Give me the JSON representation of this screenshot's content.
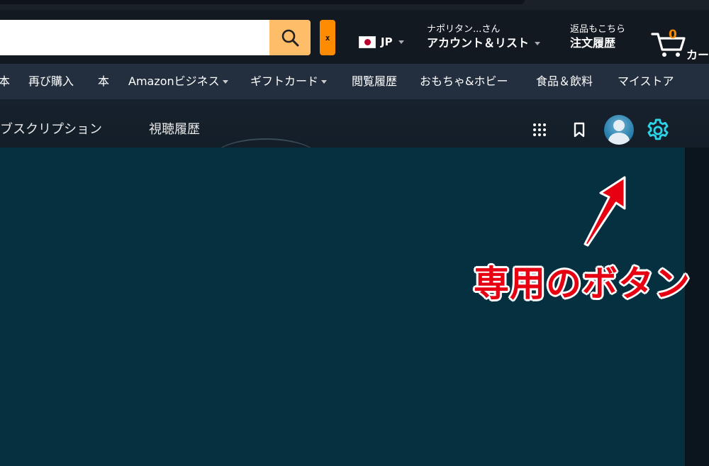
{
  "header": {
    "search": {
      "value": "",
      "placeholder": ""
    },
    "clear_label": "x",
    "language": {
      "code": "JP"
    },
    "account": {
      "greeting": "ナポリタン...さん",
      "label": "アカウント＆リスト"
    },
    "orders": {
      "line1": "返品もこちら",
      "line2": "注文履歴"
    },
    "cart": {
      "count": "0",
      "label": "カート"
    }
  },
  "nav": {
    "items": [
      {
        "label": "本",
        "caret": false
      },
      {
        "label": "再び購入",
        "caret": false
      },
      {
        "label": "本",
        "caret": false
      },
      {
        "label": "Amazonビジネス",
        "caret": true
      },
      {
        "label": "ギフトカード",
        "caret": true
      },
      {
        "label": "閲覧履歴",
        "caret": false
      },
      {
        "label": "おもちゃ&ホビー",
        "caret": false
      },
      {
        "label": "食品＆飲料",
        "caret": false
      },
      {
        "label": "マイストア",
        "caret": false
      }
    ]
  },
  "subnav": {
    "items": [
      {
        "label": "サブスクリプション"
      },
      {
        "label": "視聴履歴"
      }
    ]
  },
  "annotation": {
    "label": "専用のボタン"
  },
  "colors": {
    "accent_cyan": "#2bd5e8",
    "annotation_red": "#e60012",
    "search_button": "#febd69",
    "nav_bg": "#232f3e"
  }
}
